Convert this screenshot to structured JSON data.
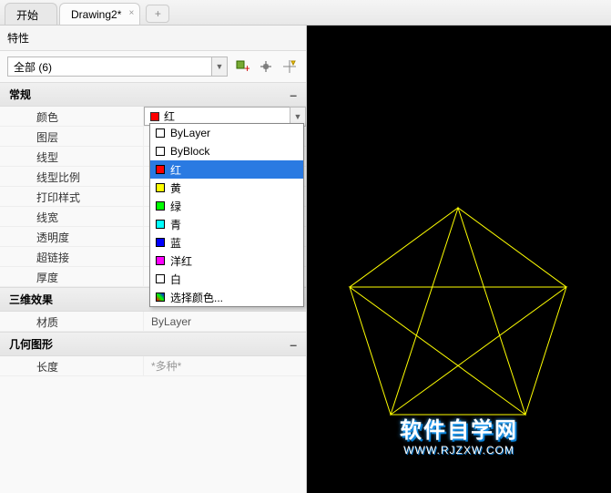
{
  "tabs": {
    "start": "开始",
    "active": "Drawing2*"
  },
  "panel": {
    "title": "特性",
    "selector": "全部 (6)"
  },
  "sections": {
    "general": "常规",
    "effects3d": "三维效果",
    "geometry": "几何图形"
  },
  "props": {
    "color": {
      "label": "颜色",
      "value": "红"
    },
    "layer": {
      "label": "图层"
    },
    "linetype": {
      "label": "线型"
    },
    "ltscale": {
      "label": "线型比例"
    },
    "plotstyle": {
      "label": "打印样式"
    },
    "lineweight": {
      "label": "线宽"
    },
    "transparency": {
      "label": "透明度"
    },
    "hyperlink": {
      "label": "超链接"
    },
    "thickness": {
      "label": "厚度"
    },
    "material": {
      "label": "材质",
      "value": "ByLayer"
    },
    "length": {
      "label": "长度",
      "value": "*多种*"
    }
  },
  "dropdown": {
    "bylayer": "ByLayer",
    "byblock": "ByBlock",
    "red": "红",
    "yellow": "黄",
    "green": "绿",
    "cyan": "青",
    "blue": "蓝",
    "magenta": "洋红",
    "white": "白",
    "select": "选择颜色..."
  },
  "colors": {
    "red": "#ff0000",
    "yellow": "#ffff00",
    "green": "#00ff00",
    "cyan": "#00ffff",
    "blue": "#0000ff",
    "magenta": "#ff00ff",
    "white": "#ffffff",
    "none": "#ffffff"
  },
  "watermark": {
    "text": "软件自学网",
    "url": "WWW.RJZXW.COM"
  }
}
